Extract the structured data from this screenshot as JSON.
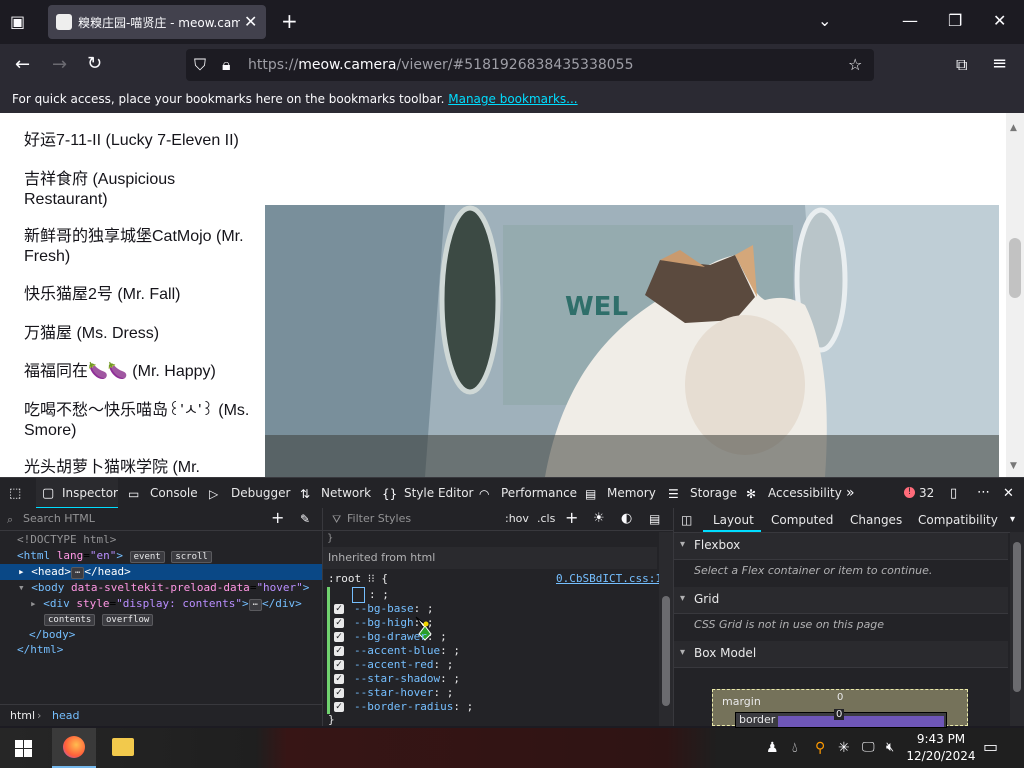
{
  "browser": {
    "tab_title": "糗糗庄园-喵贤庄 - meow.camera",
    "url_domain": "meow.camera",
    "url_prefix": "https://",
    "url_path": "/viewer/#5181926838435338055",
    "bookmarks_text": "For quick access, place your bookmarks here on the bookmarks toolbar.",
    "bookmarks_link": "Manage bookmarks..."
  },
  "page": {
    "items": [
      "好运7-11-II (Lucky 7-Eleven II)",
      "吉祥食府 (Auspicious Restaurant)",
      "新鲜哥的独享城堡CatMojo (Mr. Fresh)",
      "快乐猫屋2号 (Mr. Fall)",
      "万猫屋 (Ms. Dress)",
      "福福同在🍆🍆 (Mr. Happy)",
      "吃喝不愁～快乐喵岛꒰'ㅅ'꒱ (Ms. Smore)",
      "光头胡萝卜猫咪学院 (Mr."
    ],
    "video_sign": "WEL"
  },
  "devtools": {
    "tabs": [
      "Inspector",
      "Console",
      "Debugger",
      "Network",
      "Style Editor",
      "Performance",
      "Memory",
      "Storage",
      "Accessibility"
    ],
    "error_count": "32",
    "search_placeholder": "Search HTML",
    "filter_placeholder": "Filter Styles",
    "hov": ":hov",
    "cls": ".cls",
    "html_tree": {
      "doctype": "<!DOCTYPE html>",
      "html_open": "<html",
      "lang_attr": "lang",
      "lang_val": "\"en\"",
      "html_close_bracket": ">",
      "badge_event": "event",
      "badge_scroll": "scroll",
      "head_open": "<head>",
      "head_close": "</head>",
      "body_open": "<body",
      "body_attr": "data-sveltekit-preload-data",
      "body_val": "\"hover\"",
      "div_open": "<div",
      "div_attr": "style",
      "div_val": "\"display: contents\"",
      "div_close": "</div>",
      "badge_contents": "contents",
      "badge_overflow": "overflow",
      "body_close": "</body>",
      "html_close": "</html>",
      "ellipsis": "⋯"
    },
    "breadcrumb": [
      "html",
      "head"
    ],
    "rules": {
      "inherited_label": "Inherited from html",
      "selector": ":root",
      "source": "0.CbSBdICT.css:1",
      "props": [
        "--bg-base",
        "--bg-high",
        "--bg-drawer",
        "--accent-blue",
        "--accent-red",
        "--star-shadow",
        "--star-hover",
        "--border-radius"
      ]
    },
    "layout_tabs": [
      "Layout",
      "Computed",
      "Changes",
      "Compatibility"
    ],
    "flexbox": {
      "title": "Flexbox",
      "message": "Select a Flex container or item to continue."
    },
    "grid": {
      "title": "Grid",
      "message": "CSS Grid is not in use on this page"
    },
    "box_model": {
      "title": "Box Model",
      "margin_label": "margin",
      "border_label": "border",
      "margin_value": "0",
      "border_value": "0"
    }
  },
  "taskbar": {
    "time": "9:43 PM",
    "date": "12/20/2024"
  },
  "colors": {
    "accent": "#00ddff",
    "devtools_bg": "#232327",
    "taskbar_bg": "#202020"
  }
}
